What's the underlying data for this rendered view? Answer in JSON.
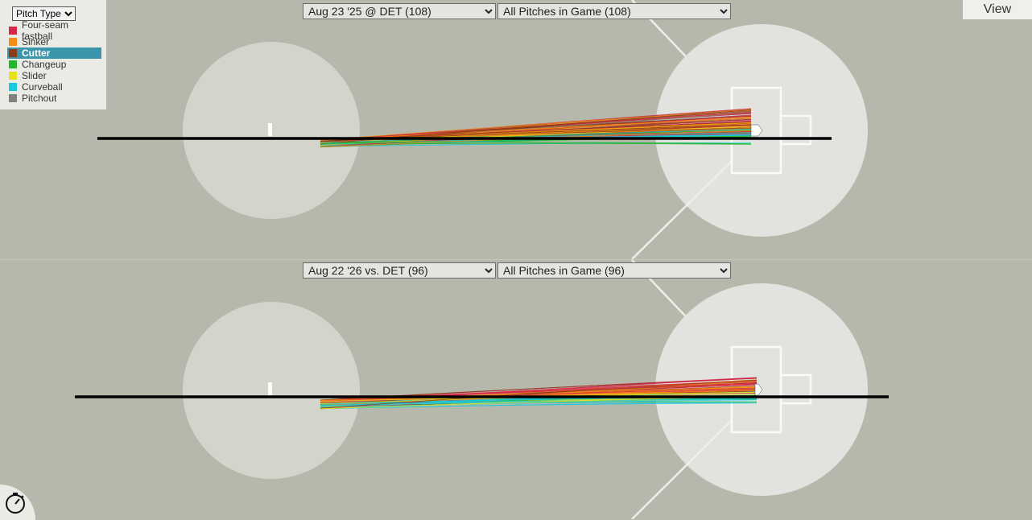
{
  "legend": {
    "selector_label": "Pitch Type",
    "items": [
      {
        "label": "Four-seam fastball",
        "color": "#d6284b"
      },
      {
        "label": "Sinker",
        "color": "#f28c14"
      },
      {
        "label": "Cutter",
        "color": "#8b3a1a",
        "active": true
      },
      {
        "label": "Changeup",
        "color": "#22b52f"
      },
      {
        "label": "Slider",
        "color": "#e8e01a"
      },
      {
        "label": "Curveball",
        "color": "#18c9e0"
      },
      {
        "label": "Pitchout",
        "color": "#808080"
      }
    ]
  },
  "toolbar": {
    "view_label": "View",
    "timer_icon": "stopwatch-icon"
  },
  "panels": [
    {
      "game": "Aug 23 '25 @ DET (108)",
      "filter": "All Pitches in Game (108)",
      "pitch_count": 108,
      "release_y": 0.5,
      "plate_y_min": 0.0,
      "plate_y_max": 1.0,
      "mix": [
        0.22,
        0.2,
        0.22,
        0.12,
        0.12,
        0.1,
        0.02
      ]
    },
    {
      "game": "Aug 22 '26 vs. DET (96)",
      "filter": "All Pitches in Game (96)",
      "pitch_count": 96,
      "release_y": 0.5,
      "plate_y_min": 0.0,
      "plate_y_max": 1.0,
      "mix": [
        0.2,
        0.2,
        0.18,
        0.14,
        0.12,
        0.16,
        0.0
      ]
    }
  ]
}
